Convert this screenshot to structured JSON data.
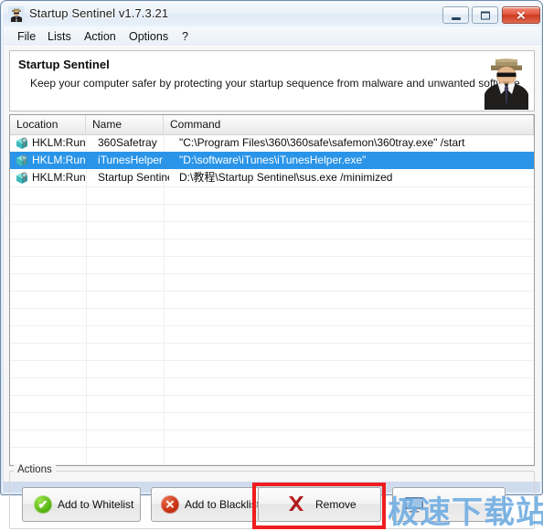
{
  "window": {
    "title": "Startup Sentinel v1.7.3.21",
    "app_icon": "sentinel-mascot-icon",
    "controls": {
      "minimize": "minimize-icon",
      "maximize": "maximize-icon",
      "close": "✕"
    }
  },
  "menu": {
    "items": [
      {
        "label": "File"
      },
      {
        "label": "Lists"
      },
      {
        "label": "Action"
      },
      {
        "label": "Options"
      },
      {
        "label": "?"
      }
    ]
  },
  "banner": {
    "title": "Startup Sentinel",
    "subtitle": "Keep your computer safer by protecting your startup sequence from malware and unwanted software",
    "mascot": "sentinel-bodyguard-icon"
  },
  "list": {
    "columns": [
      {
        "label": "Location"
      },
      {
        "label": "Name"
      },
      {
        "label": "Command"
      }
    ],
    "rows": [
      {
        "icon": "registry-key-icon",
        "location": "HKLM:Run",
        "name": "360Safetray",
        "command": "\"C:\\Program Files\\360\\360safe\\safemon\\360tray.exe\" /start",
        "selected": false
      },
      {
        "icon": "registry-key-icon",
        "location": "HKLM:Run",
        "name": "iTunesHelper",
        "command": "\"D:\\software\\iTunes\\iTunesHelper.exe\"",
        "selected": true
      },
      {
        "icon": "registry-key-icon",
        "location": "HKLM:Run",
        "name": "Startup Sentinel",
        "command": "D:\\教程\\Startup Sentinel\\sus.exe /minimized",
        "selected": false
      }
    ]
  },
  "actions": {
    "legend": "Actions",
    "buttons": [
      {
        "label": "Add to Whitelist",
        "icon": "green-check-circle-icon"
      },
      {
        "label": "Add to Blacklist",
        "icon": "red-x-circle-icon"
      },
      {
        "label": "Remove",
        "icon": "red-x-cross-icon"
      },
      {
        "label": "",
        "icon": "monitor-icon"
      }
    ]
  },
  "annotation": {
    "highlight_color": "#ef1d1d",
    "target": "Remove"
  },
  "watermark": {
    "text": "极速下载站",
    "color": "#60a4de"
  },
  "colors": {
    "selection": "#2a95e8",
    "frame": "#cfdcee",
    "close_button": "#cf3a22"
  }
}
